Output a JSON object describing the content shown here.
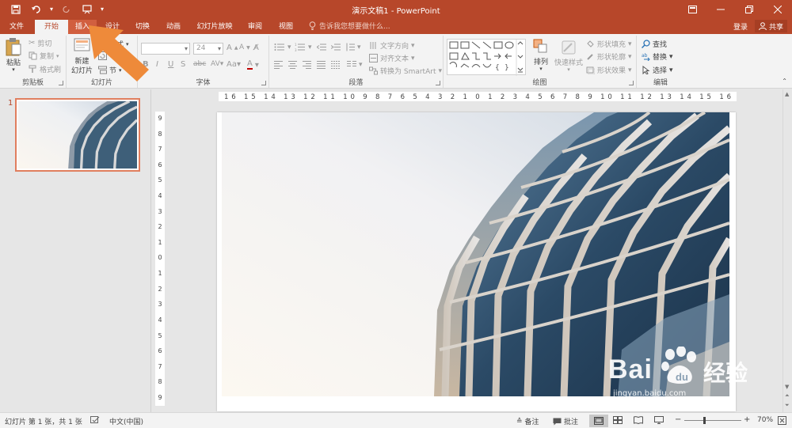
{
  "window": {
    "title": "演示文稿1 - PowerPoint"
  },
  "tabs": {
    "file": "文件",
    "home": "开始",
    "insert": "插入",
    "design": "设计",
    "transitions": "切换",
    "animations": "动画",
    "slideshow": "幻灯片放映",
    "review": "审阅",
    "view": "视图",
    "tellme": "告诉我您想要做什么...",
    "signin": "登录",
    "share": "共享"
  },
  "ribbon": {
    "clipboard": {
      "paste": "粘贴",
      "cut": "剪切",
      "copy": "复制",
      "format_painter": "格式刷",
      "label": "剪贴板"
    },
    "slides": {
      "new_slide_1": "新建",
      "new_slide_2": "幻灯片",
      "layout": "版式",
      "section": "节",
      "label": "幻灯片"
    },
    "font": {
      "size": "24",
      "label": "字体"
    },
    "paragraph": {
      "text_direction": "文字方向",
      "align_text": "对齐文本",
      "convert_smartart": "转换为 SmartArt",
      "label": "段落"
    },
    "drawing": {
      "arrange": "排列",
      "quick_styles": "快速样式",
      "shape_fill": "形状填充",
      "shape_outline": "形状轮廓",
      "shape_effects": "形状效果",
      "label": "绘图"
    },
    "editing": {
      "find": "查找",
      "replace": "替换",
      "select": "选择",
      "label": "编辑"
    }
  },
  "slide_panel": {
    "slide_number": "1"
  },
  "ruler": {
    "horizontal": "16 15 14 13 12 11 10 9 8 7 6 5 4 3 2 1 0 1 2 3 4 5 6 7 8 9 10 11 12 13 14 15 16",
    "vertical": [
      "9",
      "8",
      "7",
      "6",
      "5",
      "4",
      "3",
      "2",
      "1",
      "0",
      "1",
      "2",
      "3",
      "4",
      "5",
      "6",
      "7",
      "8",
      "9"
    ]
  },
  "status": {
    "slide_info": "幻灯片 第 1 张，共 1 张",
    "language": "中文(中国)",
    "notes": "备注",
    "comments": "批注",
    "zoom": "70%"
  },
  "watermark": {
    "brand": "Bai",
    "brand2": "经验",
    "url": "jingyan.baidu.com"
  },
  "colors": {
    "accent": "#b7472a",
    "overlay_arrow": "#ee8a3a"
  }
}
